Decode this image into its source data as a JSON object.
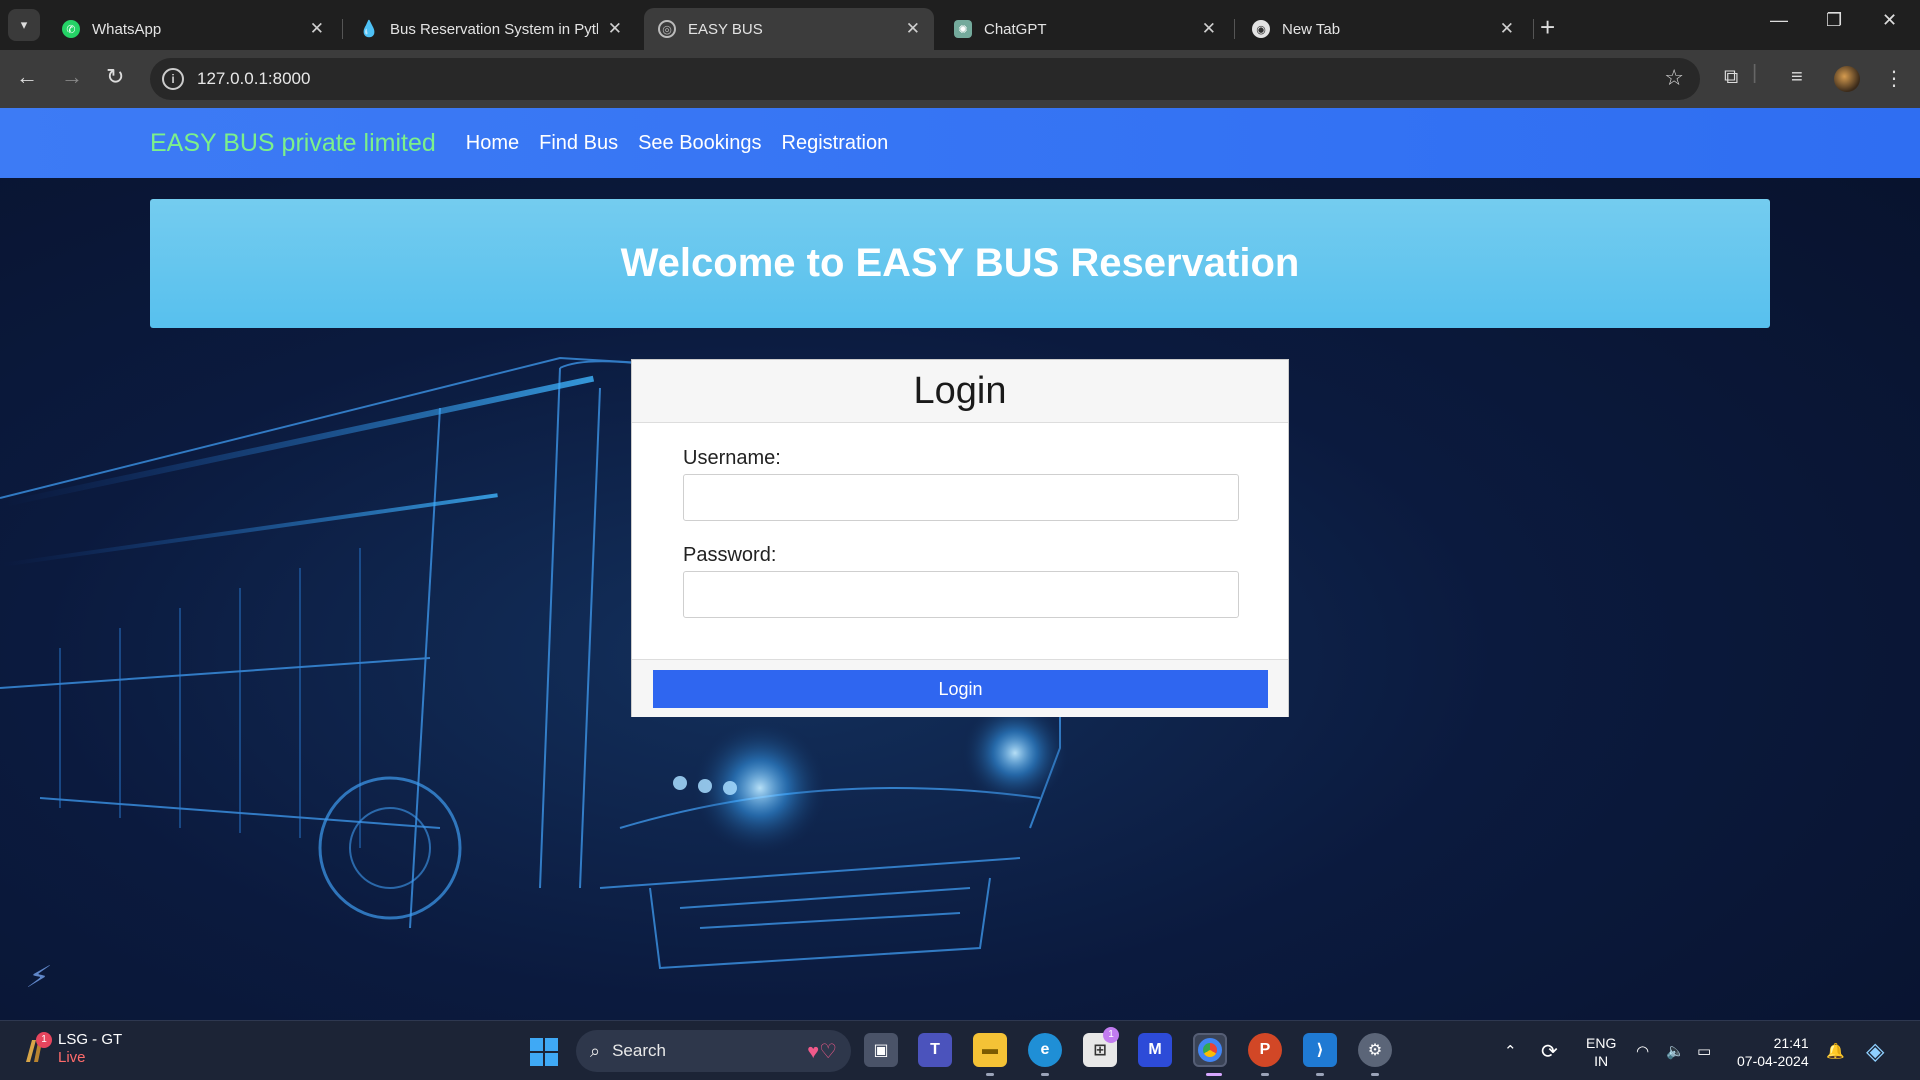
{
  "browser": {
    "tabs": [
      {
        "title": "WhatsApp",
        "icon": "whatsapp-icon",
        "active": false
      },
      {
        "title": "Bus Reservation System in Pyth",
        "icon": "drupal-icon",
        "active": false
      },
      {
        "title": "EASY BUS",
        "icon": "globe-icon",
        "active": true
      },
      {
        "title": "ChatGPT",
        "icon": "chatgpt-icon",
        "active": false
      },
      {
        "title": "New Tab",
        "icon": "chrome-icon",
        "active": false
      }
    ],
    "url": "127.0.0.1:8000"
  },
  "site": {
    "brand": "EASY BUS private limited",
    "nav": [
      "Home",
      "Find Bus",
      "See Bookings",
      "Registration"
    ],
    "hero_title": "Welcome to EASY BUS Reservation",
    "login": {
      "title": "Login",
      "username_label": "Username:",
      "password_label": "Password:",
      "username_value": "",
      "password_value": "",
      "button": "Login"
    },
    "colors": {
      "navbar": "#3d7bf5",
      "brand": "#7cf08a",
      "hero": "#5ec4ef",
      "button": "#2f66f0"
    }
  },
  "taskbar": {
    "weather_title": "LSG - GT",
    "weather_status": "Live",
    "weather_badge": "1",
    "search_label": "Search",
    "store_badge": "1",
    "lang_line1": "ENG",
    "lang_line2": "IN",
    "time": "21:41",
    "date": "07-04-2024"
  }
}
